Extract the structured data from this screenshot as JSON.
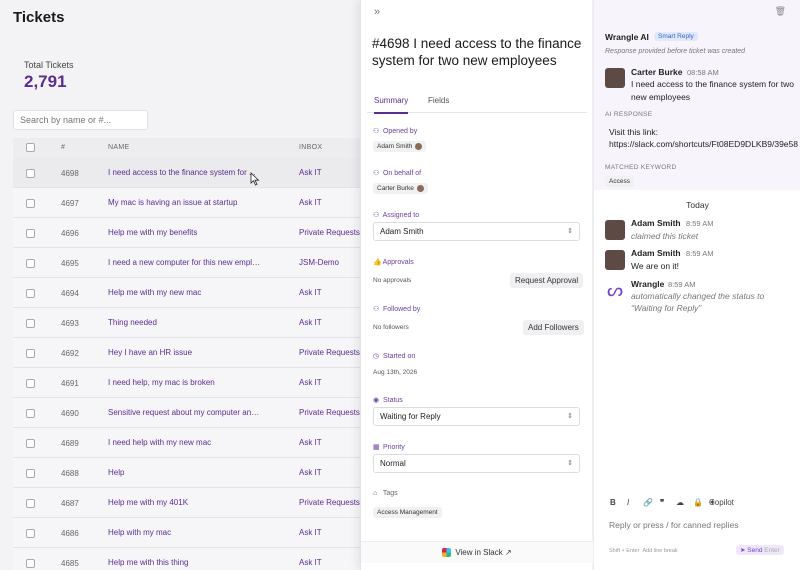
{
  "tickets": {
    "title": "Tickets",
    "total_label": "Total Tickets",
    "total_value": "2,791",
    "search_placeholder": "Search by name or #...",
    "columns": [
      "#",
      "NAME",
      "INBOX"
    ],
    "rows": [
      {
        "num": "4698",
        "name": "I need access to the finance system for ...",
        "inbox": "Ask IT"
      },
      {
        "num": "4697",
        "name": "My mac is having an issue at startup",
        "inbox": "Ask IT"
      },
      {
        "num": "4696",
        "name": "Help me with my benefits",
        "inbox": "Private Requests"
      },
      {
        "num": "4695",
        "name": "I need a new computer for this new emplo...",
        "inbox": "JSM-Demo"
      },
      {
        "num": "4694",
        "name": "Help me with my new mac",
        "inbox": "Ask IT"
      },
      {
        "num": "4693",
        "name": "Thing needed",
        "inbox": "Ask IT"
      },
      {
        "num": "4692",
        "name": "Hey I have an HR issue",
        "inbox": "Private Requests"
      },
      {
        "num": "4691",
        "name": "I need help, my mac is broken",
        "inbox": "Ask IT"
      },
      {
        "num": "4690",
        "name": "Sensitive request about my computer and ...",
        "inbox": "Private Requests"
      },
      {
        "num": "4689",
        "name": "I need help with my new mac",
        "inbox": "Ask IT"
      },
      {
        "num": "4688",
        "name": "Help",
        "inbox": "Ask IT"
      },
      {
        "num": "4687",
        "name": "Help me with my 401K",
        "inbox": "Private Requests"
      },
      {
        "num": "4686",
        "name": "Help with my mac",
        "inbox": "Ask IT"
      },
      {
        "num": "4685",
        "name": "Help me with this thing",
        "inbox": "Ask IT"
      }
    ]
  },
  "detail": {
    "title": "#4698 I need access to the finance system for two new employees",
    "tabs": [
      "Summary",
      "Fields"
    ],
    "opened_by_label": "Opened by",
    "opened_by": "Adam Smith",
    "on_behalf_label": "On behalf of",
    "on_behalf": "Carter Burke",
    "assigned_label": "Assigned to",
    "assigned": "Adam Smith",
    "approvals_label": "Approvals",
    "approvals_value": "No approvals",
    "request_approval": "Request Approval",
    "followed_label": "Followed by",
    "followed_value": "No followers",
    "add_followers": "Add Followers",
    "started_label": "Started on",
    "started_value": "Aug 13th, 2026",
    "status_label": "Status",
    "status_value": "Waiting for Reply",
    "priority_label": "Priority",
    "priority_value": "Normal",
    "tags_label": "Tags",
    "tag": "Access Management",
    "view_in_slack": "View in Slack"
  },
  "thread": {
    "wrangle_ai": "Wrangle AI",
    "smart_reply": "Smart Reply",
    "response_before": "Response provided before ticket was created",
    "m1_name": "Carter Burke",
    "m1_time": "08:58 AM",
    "m1_text": "I need access to the finance system for two new employees",
    "ai_response_label": "AI RESPONSE",
    "ai_text_1": "Visit this link:",
    "ai_text_2": "https://slack.com/shortcuts/Ft08ED9DLKB9/39e58",
    "matched_label": "MATCHED KEYWORD",
    "matched_value": "Access",
    "today": "Today",
    "m2_name": "Adam Smith",
    "m2_time": "8:59 AM",
    "m2_text": "claimed this ticket",
    "m3_name": "Adam Smith",
    "m3_time": "8:59 AM",
    "m3_text": "We are on it!",
    "m4_name": "Wrangle",
    "m4_time": "8:59 AM",
    "m4_text_1": "automatically changed the status to",
    "m4_text_2": "“Waiting for Reply”",
    "copilot": "Copilot",
    "reply_placeholder": "Reply or press / for canned replies",
    "hint_1": "Shift + Enter",
    "hint_2": "Add line break",
    "send": "Send",
    "send_shortcut": "Enter"
  }
}
